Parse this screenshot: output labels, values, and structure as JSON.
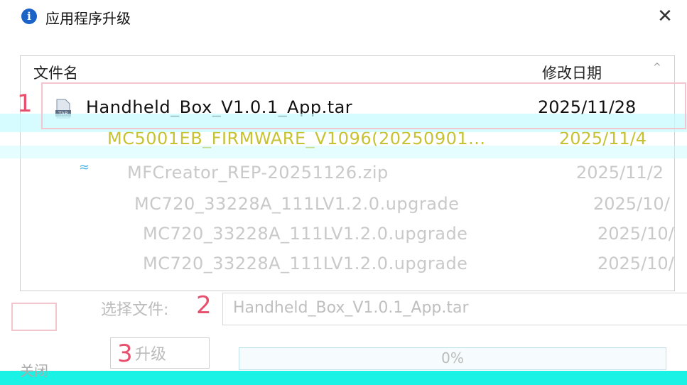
{
  "window": {
    "title": "应用程序升级",
    "close_glyph": "✕"
  },
  "list": {
    "columns": {
      "name": "文件名",
      "date": "修改日期"
    },
    "sort_glyph": "^",
    "rows": [
      {
        "name": "Handheld_Box_V1.0.1_App.tar",
        "date": "2025/11/28",
        "state": "selected"
      },
      {
        "name": "MC5001EB_FIRMWARE_V1096(20250901...",
        "date": "2025/11/4",
        "state": "yellow"
      },
      {
        "name": "MFCreator_REP-20251126.zip",
        "date": "2025/11/2",
        "state": "faded"
      },
      {
        "name": "MC720_33228A_111LV1.2.0.upgrade",
        "date": "2025/10/",
        "state": "faded"
      },
      {
        "name": "MC720_33228A_111LV1.2.0.upgrade",
        "date": "2025/10/",
        "state": "faded"
      },
      {
        "name": "MC720_33228A_111LV1.2.0.upgrade",
        "date": "2025/10/",
        "state": "faded"
      }
    ]
  },
  "markers": {
    "m1": "1",
    "m2": "2",
    "m3": "3"
  },
  "choose": {
    "label": "选择文件:",
    "value": "Handheld_Box_V1.0.1_App.tar"
  },
  "upgrade": {
    "label": "升级"
  },
  "progress": {
    "text": "0%",
    "value": 0.0
  },
  "footer": {
    "close_label": "关闭"
  },
  "colors": {
    "accent": "#1b63c6",
    "marker": "#e84f6d",
    "progress": "#06b025"
  }
}
